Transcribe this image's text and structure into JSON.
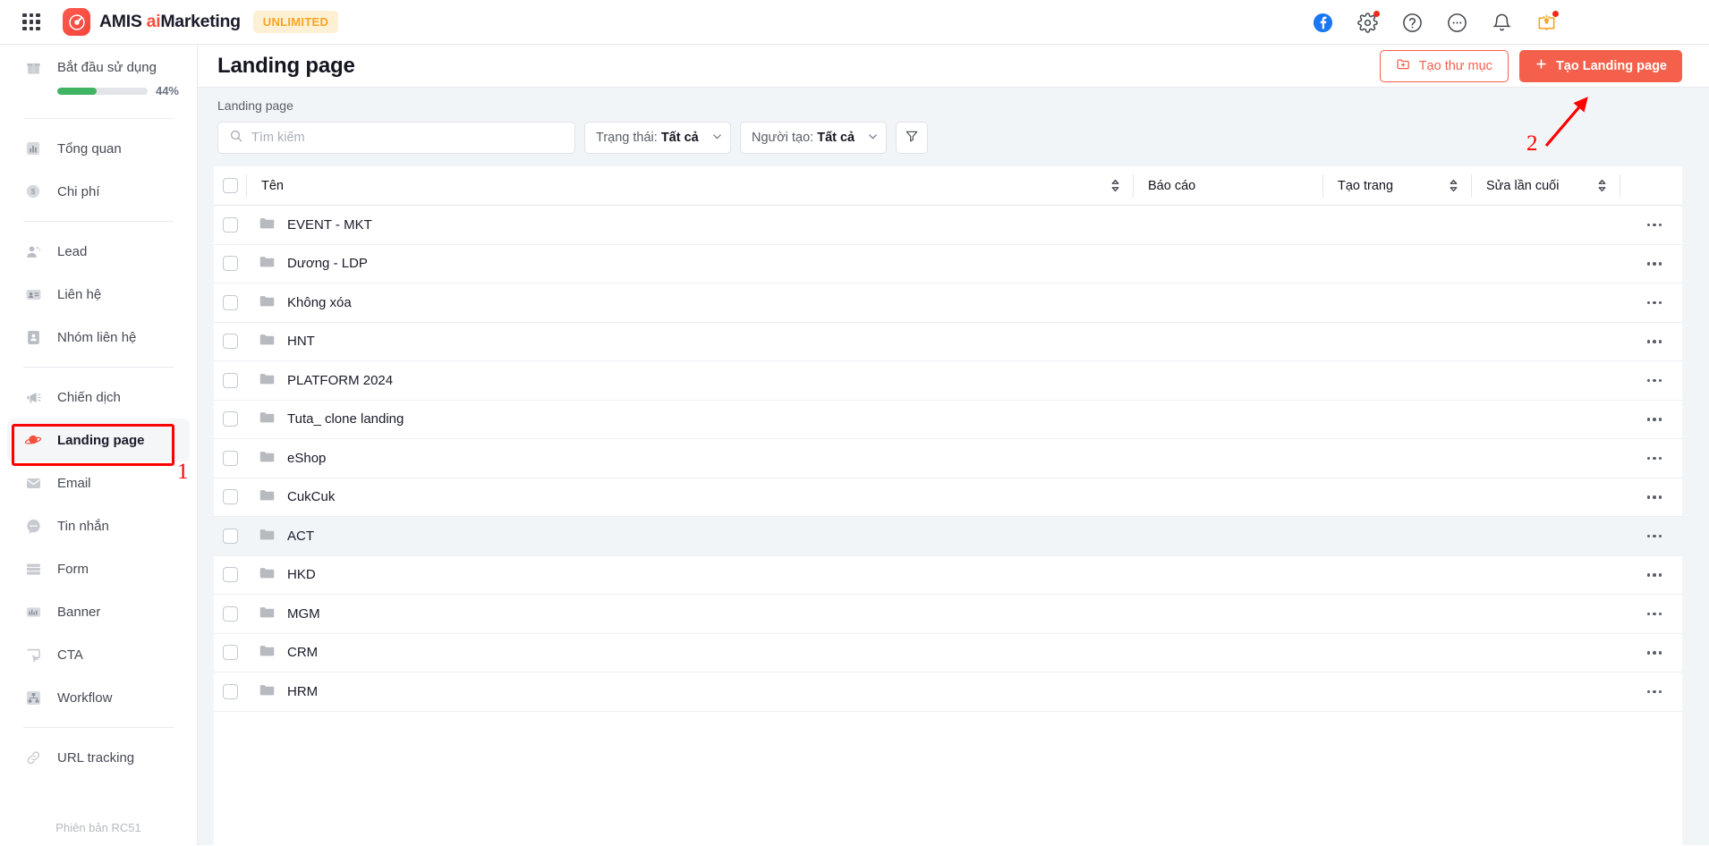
{
  "topbar": {
    "app_grid_label": "apps-grid",
    "brand_prefix": "AMIS ",
    "brand_ai": "ai",
    "brand_suffix": "Marketing",
    "badge": "UNLIMITED",
    "icons": [
      {
        "name": "facebook-icon",
        "badge": false
      },
      {
        "name": "settings-gear-icon",
        "badge": true
      },
      {
        "name": "help-question-icon",
        "badge": false
      },
      {
        "name": "more-options-icon",
        "badge": false
      },
      {
        "name": "notification-bell-icon",
        "badge": false
      },
      {
        "name": "guide-book-icon",
        "badge": true
      }
    ]
  },
  "sidebar": {
    "getting_started": {
      "label": "Bắt đầu sử dụng",
      "percent_label": "44%",
      "percent_value": 44,
      "bar_color": "#3fb564"
    },
    "groups": [
      {
        "items": [
          {
            "label": "Tổng quan",
            "icon": "chart-bar-icon",
            "active": false
          },
          {
            "label": "Chi phí",
            "icon": "dollar-circle-icon",
            "active": false
          }
        ]
      },
      {
        "items": [
          {
            "label": "Lead",
            "icon": "lead-person-icon",
            "active": false
          },
          {
            "label": "Liên hệ",
            "icon": "contact-card-icon",
            "active": false
          },
          {
            "label": "Nhóm liên hệ",
            "icon": "contact-group-icon",
            "active": false
          }
        ]
      },
      {
        "items": [
          {
            "label": "Chiến dịch",
            "icon": "megaphone-icon",
            "active": false
          },
          {
            "label": "Landing page",
            "icon": "landing-page-icon",
            "active": true
          },
          {
            "label": "Email",
            "icon": "envelope-icon",
            "active": false
          },
          {
            "label": "Tin nhắn",
            "icon": "chat-bubble-icon",
            "active": false
          },
          {
            "label": "Form",
            "icon": "form-icon",
            "active": false
          },
          {
            "label": "Banner",
            "icon": "banner-icon",
            "active": false
          },
          {
            "label": "CTA",
            "icon": "cta-icon",
            "active": false
          },
          {
            "label": "Workflow",
            "icon": "workflow-icon",
            "active": false
          }
        ]
      },
      {
        "items": [
          {
            "label": "URL tracking",
            "icon": "link-chain-icon",
            "active": false
          }
        ]
      }
    ],
    "version": "Phiên bản RC51"
  },
  "page": {
    "title": "Landing page",
    "breadcrumb": "Landing page",
    "create_folder_button": "Tạo thư mục",
    "create_landing_button": "Tạo Landing page",
    "accent_color": "#f4604b"
  },
  "filters": {
    "search_placeholder": "Tìm kiếm",
    "search_value": "",
    "status": {
      "label": "Trạng thái:",
      "value": "Tất cả"
    },
    "creator": {
      "label": "Người tạo:",
      "value": "Tất cả"
    },
    "filter_icon": "funnel-filter-icon"
  },
  "table": {
    "columns": [
      {
        "key": "name",
        "label": "Tên",
        "sortable": true
      },
      {
        "key": "report",
        "label": "Báo cáo",
        "sortable": false
      },
      {
        "key": "create",
        "label": "Tạo trang",
        "sortable": true
      },
      {
        "key": "edit",
        "label": "Sửa lần cuối",
        "sortable": true
      }
    ],
    "rows": [
      {
        "name": "EVENT - MKT",
        "report": "",
        "create": "",
        "edit": "",
        "hover": false
      },
      {
        "name": "Dương - LDP",
        "report": "",
        "create": "",
        "edit": "",
        "hover": false
      },
      {
        "name": "Không xóa",
        "report": "",
        "create": "",
        "edit": "",
        "hover": false
      },
      {
        "name": "HNT",
        "report": "",
        "create": "",
        "edit": "",
        "hover": false
      },
      {
        "name": "PLATFORM 2024",
        "report": "",
        "create": "",
        "edit": "",
        "hover": false
      },
      {
        "name": "Tuta_ clone landing",
        "report": "",
        "create": "",
        "edit": "",
        "hover": false
      },
      {
        "name": "eShop",
        "report": "",
        "create": "",
        "edit": "",
        "hover": false
      },
      {
        "name": "CukCuk",
        "report": "",
        "create": "",
        "edit": "",
        "hover": false
      },
      {
        "name": "ACT",
        "report": "",
        "create": "",
        "edit": "",
        "hover": true
      },
      {
        "name": "HKD",
        "report": "",
        "create": "",
        "edit": "",
        "hover": false
      },
      {
        "name": "MGM",
        "report": "",
        "create": "",
        "edit": "",
        "hover": false
      },
      {
        "name": "CRM",
        "report": "",
        "create": "",
        "edit": "",
        "hover": false
      },
      {
        "name": "HRM",
        "report": "",
        "create": "",
        "edit": "",
        "hover": false
      }
    ]
  },
  "annotations": {
    "marker_1": "1",
    "marker_2": "2",
    "color": "#ff0000"
  }
}
